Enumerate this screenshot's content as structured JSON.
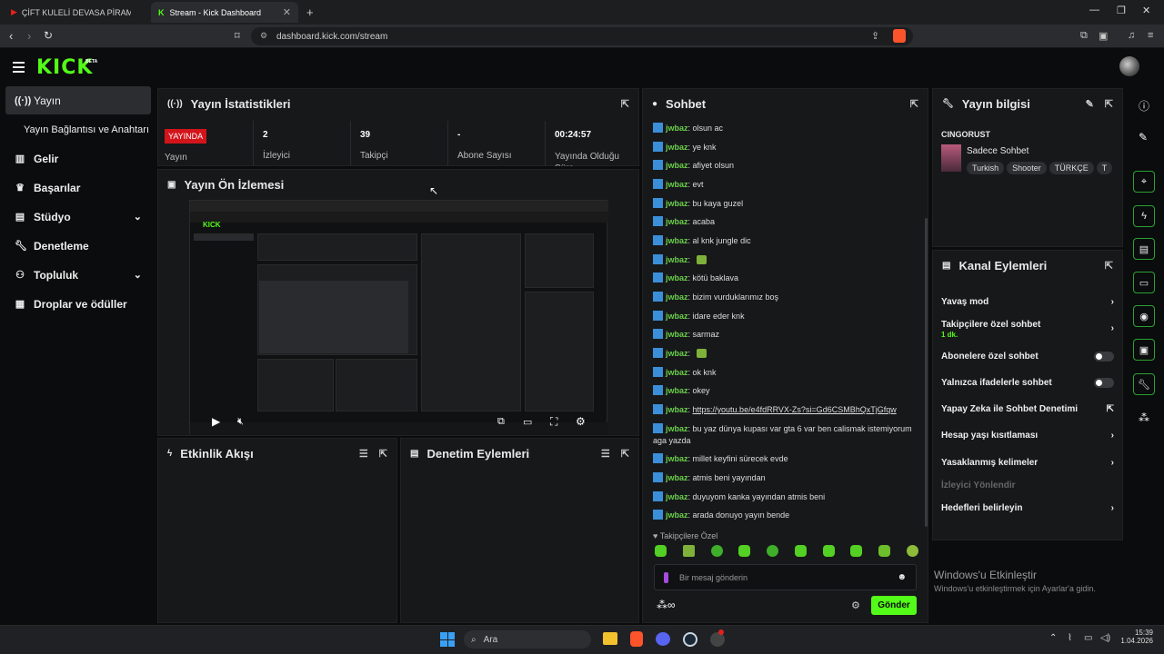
{
  "browser": {
    "tabs": [
      {
        "label": "ÇİFT KULELİ DEVASA PİRAMİT EVDE ..."
      },
      {
        "label": "Stream - Kick Dashboard"
      }
    ],
    "url": "dashboard.kick.com/stream"
  },
  "header": {
    "logo": "KICK",
    "beta": "BETA"
  },
  "sidebar": {
    "items": [
      {
        "label": "Yayın",
        "icon": "broadcast-icon"
      },
      {
        "label": "Yayın Bağlantısı ve Anahtarı"
      },
      {
        "label": "Gelir",
        "icon": "chart-icon"
      },
      {
        "label": "Başarılar",
        "icon": "trophy-icon"
      },
      {
        "label": "Stüdyo",
        "icon": "studio-icon"
      },
      {
        "label": "Denetleme",
        "icon": "wrench-icon"
      },
      {
        "label": "Topluluk",
        "icon": "people-icon"
      },
      {
        "label": "Droplar ve ödüller",
        "icon": "gift-icon"
      }
    ]
  },
  "stats": {
    "title": "Yayın İstatistikleri",
    "status_badge": "YAYINDA",
    "status_label": "Yayın",
    "viewers": "2",
    "viewers_label": "İzleyici",
    "followers": "39",
    "followers_label": "Takipçi",
    "subs": "-",
    "subs_label": "Abone Sayısı",
    "duration": "00:24:57",
    "duration_label": "Yayında Olduğu Süre"
  },
  "preview": {
    "title": "Yayın Ön İzlemesi"
  },
  "activity": {
    "title": "Etkinlik Akışı"
  },
  "moderation": {
    "title": "Denetim Eylemleri"
  },
  "chat": {
    "title": "Sohbet",
    "messages": [
      {
        "user": "jwbaz",
        "text": "olsun ac"
      },
      {
        "user": "jwbaz",
        "text": "ye knk"
      },
      {
        "user": "jwbaz",
        "text": "afiyet olsun"
      },
      {
        "user": "jwbaz",
        "text": "evt"
      },
      {
        "user": "jwbaz",
        "text": "bu kaya guzel"
      },
      {
        "user": "jwbaz",
        "text": "acaba"
      },
      {
        "user": "jwbaz",
        "text": "al knk jungle dic"
      },
      {
        "user": "jwbaz",
        "text": ""
      },
      {
        "user": "jwbaz",
        "text": "kötü baklava"
      },
      {
        "user": "jwbaz",
        "text": "bizim vurduklarımız boş"
      },
      {
        "user": "jwbaz",
        "text": "idare eder knk"
      },
      {
        "user": "jwbaz",
        "text": "sarmaz"
      },
      {
        "user": "jwbaz",
        "text": ""
      },
      {
        "user": "jwbaz",
        "text": "ok knk"
      },
      {
        "user": "jwbaz",
        "text": "okey"
      },
      {
        "user": "jwbaz",
        "text": "https://youtu.be/e4fdRRVX-Zs?si=Gd6CSMBhQxTjGfqw"
      },
      {
        "user": "jwbaz",
        "text": "bu yaz dünya kupası var gta 6 var ben calismak istemiyorum aga yazda"
      },
      {
        "user": "jwbaz",
        "text": "millet keyfini sürecek evde"
      },
      {
        "user": "jwbaz",
        "text": "atmis beni yayından"
      },
      {
        "user": "jwbaz",
        "text": "duyuyom kanka yayından atmis beni"
      },
      {
        "user": "jwbaz",
        "text": "arada donuyo yayın bende"
      }
    ],
    "followers_only": "Takipçilere Özel",
    "placeholder": "Bir mesaj gönderin",
    "send": "Gönder"
  },
  "stream_info": {
    "title": "Yayın bilgisi",
    "channel": "CINGORUST",
    "stream_title": "Sadece Sohbet",
    "tags": [
      "Turkish",
      "Shooter",
      "TÜRKÇE",
      "T"
    ]
  },
  "channel_actions": {
    "title": "Kanal Eylemleri",
    "items": [
      {
        "label": "Yavaş mod"
      },
      {
        "label": "Takipçilere özel sohbet",
        "sub": "1 dk."
      },
      {
        "label": "Abonelere özel sohbet"
      },
      {
        "label": "Yalnızca ifadelerle sohbet"
      },
      {
        "label": "Yapay Zeka ile Sohbet Denetimi"
      },
      {
        "label": "Hesap yaşı kısıtlaması"
      },
      {
        "label": "Yasaklanmış kelimeler"
      },
      {
        "label": "İzleyici Yönlendir"
      },
      {
        "label": "Hedefleri belirleyin"
      }
    ]
  },
  "watermark": {
    "title": "Windows'u Etkinleştir",
    "sub": "Windows'u etkinleştirmek için Ayarlar'a gidin."
  },
  "taskbar": {
    "search": "Ara",
    "time": "15:39",
    "date": "1.04.2026"
  }
}
